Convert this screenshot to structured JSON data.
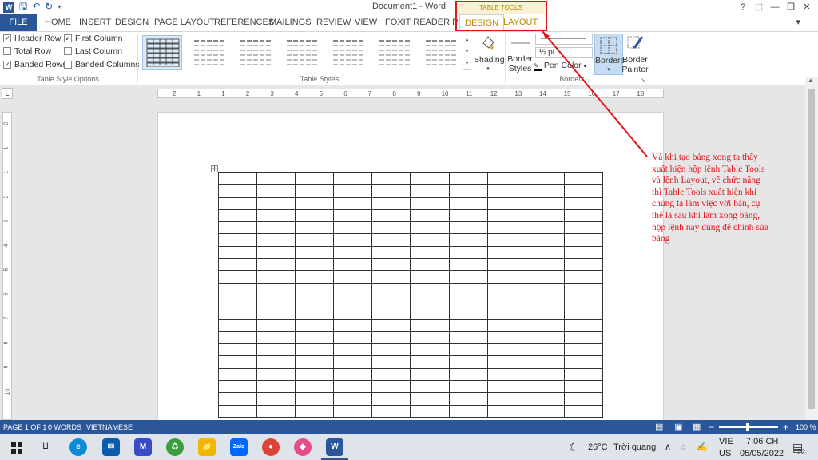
{
  "titlebar": {
    "title": "Document1 - Word",
    "word_logo": "W",
    "qat_icons": [
      "save-icon",
      "undo-icon",
      "redo-icon",
      "customize-icon"
    ],
    "window_controls": [
      "help-icon",
      "ribbon-display-icon",
      "minimize-icon",
      "restore-icon",
      "close-icon"
    ]
  },
  "tabs": {
    "file": "FILE",
    "home": "HOME",
    "insert": "INSERT",
    "design": "DESIGN",
    "page_layout": "PAGE LAYOUT",
    "references": "REFERENCES",
    "mailings": "MAILINGS",
    "review": "REVIEW",
    "view": "VIEW",
    "foxit": "FOXIT READER PDF",
    "contextual_header": "TABLE TOOLS",
    "ctx_design": "DESIGN",
    "ctx_layout": "LAYOUT"
  },
  "ribbon": {
    "table_style_options": {
      "label": "Table Style Options",
      "header_row": {
        "label": "Header Row",
        "checked": true
      },
      "total_row": {
        "label": "Total Row",
        "checked": false
      },
      "banded_rows": {
        "label": "Banded Rows",
        "checked": true
      },
      "first_column": {
        "label": "First Column",
        "checked": true
      },
      "last_column": {
        "label": "Last Column",
        "checked": false
      },
      "banded_columns": {
        "label": "Banded Columns",
        "checked": false
      }
    },
    "table_styles": {
      "label": "Table Styles"
    },
    "shading": {
      "label": "Shading"
    },
    "borders": {
      "label": "Borders",
      "border_styles_1": "Border",
      "border_styles_2": "Styles",
      "weight": "½ pt",
      "pen_color": "Pen Color",
      "borders_btn": "Borders",
      "painter_1": "Border",
      "painter_2": "Painter"
    }
  },
  "ruler": {
    "tab_selector": "L",
    "h_numbers": [
      "2",
      "1",
      "1",
      "2",
      "3",
      "4",
      "5",
      "6",
      "7",
      "8",
      "9",
      "10",
      "11",
      "12",
      "13",
      "14",
      "15",
      "16",
      "17",
      "18"
    ],
    "v_numbers": [
      "2",
      "1",
      "1",
      "2",
      "3",
      "4",
      "5",
      "6",
      "7",
      "8",
      "9",
      "10"
    ]
  },
  "table": {
    "rows": 20,
    "cols": 10
  },
  "annotation": {
    "text": "Và khi tạo bảng xong ta thấy xuất hiện hộp lệnh Table Tools và lệnh Layout, về chức năng thì Table Tools xuất hiện khi chúng ta làm việc với bản, cụ thể là sau khi làm xong bảng, hộp lệnh này dùng để chỉnh sửa bảng",
    "color": "#e2141c"
  },
  "status": {
    "page": "PAGE 1 OF 1",
    "words": "0 WORDS",
    "language": "VIETNAMESE",
    "zoom": "100 %",
    "zoom_minus": "−",
    "zoom_plus": "+"
  },
  "taskbar": {
    "weather_temp": "26°C",
    "weather_text": "Trời quang",
    "lang_1": "VIE",
    "lang_2": "US",
    "time": "7:06 CH",
    "date": "05/05/2022",
    "notifications": "22",
    "apps": [
      "start-icon",
      "task-view-icon",
      "edge-icon",
      "mail-icon",
      "app-icon",
      "app-icon-2",
      "file-explorer-icon",
      "zalo-icon",
      "chrome-icon",
      "app-icon-3",
      "word-icon"
    ],
    "zalo_label": "Zalo",
    "word_label": "W"
  },
  "colors": {
    "word_blue": "#2b579a",
    "context_gold": "#b88a00",
    "annotation_red": "#e2141c"
  }
}
